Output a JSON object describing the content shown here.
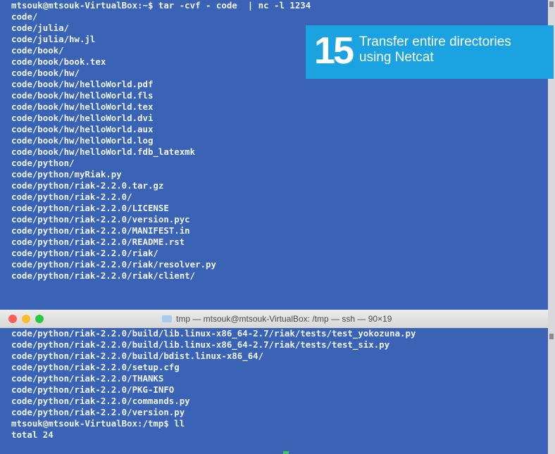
{
  "top_terminal": {
    "lines": [
      "mtsouk@mtsouk-VirtualBox:~$ tar -cvf - code  | nc -l 1234",
      "code/",
      "code/julia/",
      "code/julia/hw.jl",
      "code/book/",
      "code/book/book.tex",
      "code/book/hw/",
      "code/book/hw/helloWorld.pdf",
      "code/book/hw/helloWorld.fls",
      "code/book/hw/helloWorld.tex",
      "code/book/hw/helloWorld.dvi",
      "code/book/hw/helloWorld.aux",
      "code/book/hw/helloWorld.log",
      "code/book/hw/helloWorld.fdb_latexmk",
      "code/python/",
      "code/python/myRiak.py",
      "code/python/riak-2.2.0.tar.gz",
      "code/python/riak-2.2.0/",
      "code/python/riak-2.2.0/LICENSE",
      "code/python/riak-2.2.0/version.pyc",
      "code/python/riak-2.2.0/MANIFEST.in",
      "code/python/riak-2.2.0/README.rst",
      "code/python/riak-2.2.0/riak/",
      "code/python/riak-2.2.0/riak/resolver.py",
      "code/python/riak-2.2.0/riak/client/"
    ]
  },
  "window_title": "tmp — mtsouk@mtsouk-VirtualBox: /tmp — ssh — 90×19",
  "bottom_terminal": {
    "lines": [
      "code/python/riak-2.2.0/build/lib.linux-x86_64-2.7/riak/tests/test_yokozuna.py",
      "code/python/riak-2.2.0/build/lib.linux-x86_64-2.7/riak/tests/test_six.py",
      "code/python/riak-2.2.0/build/bdist.linux-x86_64/",
      "code/python/riak-2.2.0/setup.cfg",
      "code/python/riak-2.2.0/THANKS",
      "code/python/riak-2.2.0/PKG-INFO",
      "code/python/riak-2.2.0/commands.py",
      "code/python/riak-2.2.0/version.py",
      "mtsouk@mtsouk-VirtualBox:/tmp$ ll",
      "total 24"
    ]
  },
  "badge": {
    "number": "15",
    "line1": "Transfer entire directories",
    "line2": "using Netcat"
  },
  "colors": {
    "terminal_bg": "#3a63b5",
    "badge_bg": "#1aa3e0",
    "close": "#fc5f57",
    "minimize": "#fdbc2e",
    "zoom": "#28c840"
  },
  "icons": {
    "folder": "folder-icon",
    "close": "close-button",
    "minimize": "minimize-button",
    "zoom": "zoom-button"
  }
}
